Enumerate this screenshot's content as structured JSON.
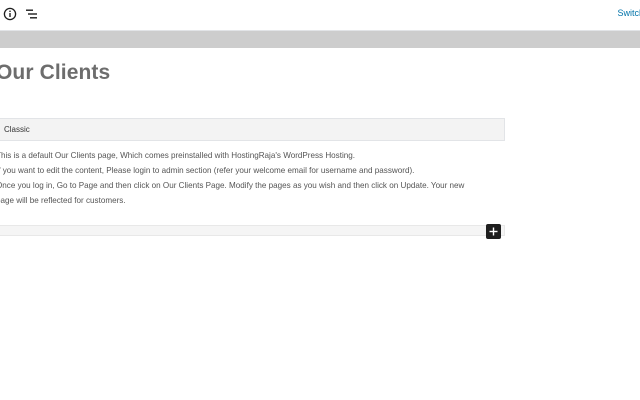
{
  "toolbar": {
    "info_icon": "info-icon",
    "outline_icon": "block-navigation-icon",
    "switch_label": "Switch"
  },
  "editor": {
    "page_title": "Our Clients",
    "classic_block_label": "Classic",
    "paragraphs": [
      "This is a default Our Clients page, Which comes preinstalled with HostingRaja's WordPress Hosting.",
      "If you want to edit the content, Please login to admin section (refer your welcome email for username and password).",
      "Once you log in, Go to Page and then click on Our Clients Page. Modify the pages as you wish and then click on Update. Your new",
      "page will be reflected for customers."
    ],
    "add_block_icon": "plus-icon"
  },
  "colors": {
    "link": "#0073aa",
    "band": "#cdcdcd",
    "title": "#6d6d6d",
    "add_button": "#1e1e1e"
  }
}
